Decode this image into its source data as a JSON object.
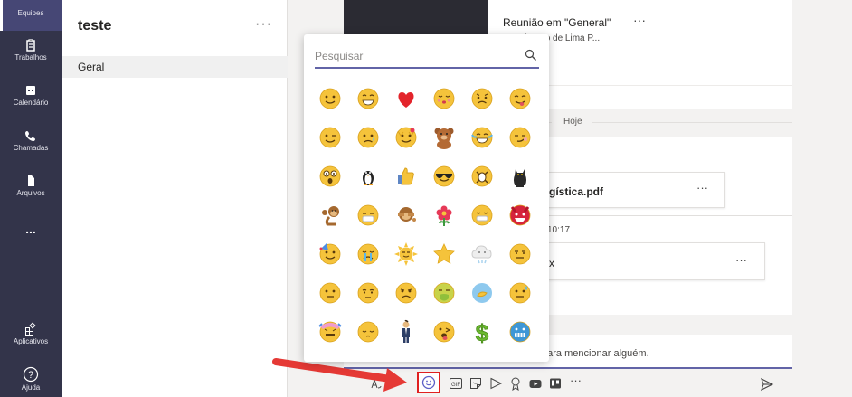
{
  "rail": {
    "items": [
      {
        "label": "Equipes",
        "icon": "teams-icon"
      },
      {
        "label": "Trabalhos",
        "icon": "assignments-icon"
      },
      {
        "label": "Calendário",
        "icon": "calendar-icon"
      },
      {
        "label": "Chamadas",
        "icon": "phone-icon"
      },
      {
        "label": "Arquivos",
        "icon": "file-icon"
      },
      {
        "label": "...",
        "icon": "more-icon"
      },
      {
        "label": "Aplicativos",
        "icon": "apps-icon"
      },
      {
        "label": "Ajuda",
        "icon": "help-icon"
      }
    ]
  },
  "team": {
    "name": "teste",
    "more": "···",
    "channels": [
      "Geral"
    ]
  },
  "conversation": {
    "meeting_title": "Reunião em \"General\"",
    "meeting_more": "···",
    "meeting_sub": "or: Eduardo de Lima P...",
    "today_label": "Hoje",
    "file1_name": "gística.pdf",
    "file1_more": "···",
    "time": "10:17",
    "file2_name": "x",
    "file2_more": "···",
    "compose_hint": "para mencionar alguém."
  },
  "picker": {
    "search_placeholder": "Pesquisar",
    "emojis": [
      [
        "smile",
        "grin",
        "heart",
        "kiss",
        "sad",
        "tongue"
      ],
      [
        "wink",
        "worried",
        "cat-smile",
        "bear",
        "laugh-cry",
        "smirk"
      ],
      [
        "shock",
        "penguin",
        "thumbs-up",
        "cool",
        "egg",
        "cat"
      ],
      [
        "monkey",
        "sick",
        "see-no-evil",
        "flower",
        "cold",
        "devil"
      ],
      [
        "party",
        "cry",
        "sun",
        "star",
        "snow-cloud",
        "annoyed"
      ],
      [
        "neutral",
        "speechless",
        "unhappy",
        "vomit",
        "wave",
        "sweat"
      ],
      [
        "sweat-hat",
        "sleepy",
        "man-suit",
        "tongue-wink",
        "dollar",
        "frozen"
      ]
    ]
  },
  "toolbar": {
    "icons": [
      "format-icon",
      "emoji-icon",
      "gif-icon",
      "sticker-icon",
      "meet-icon",
      "praise-icon",
      "stream-icon",
      "trello-icon",
      "more-icon"
    ],
    "more": "···"
  }
}
